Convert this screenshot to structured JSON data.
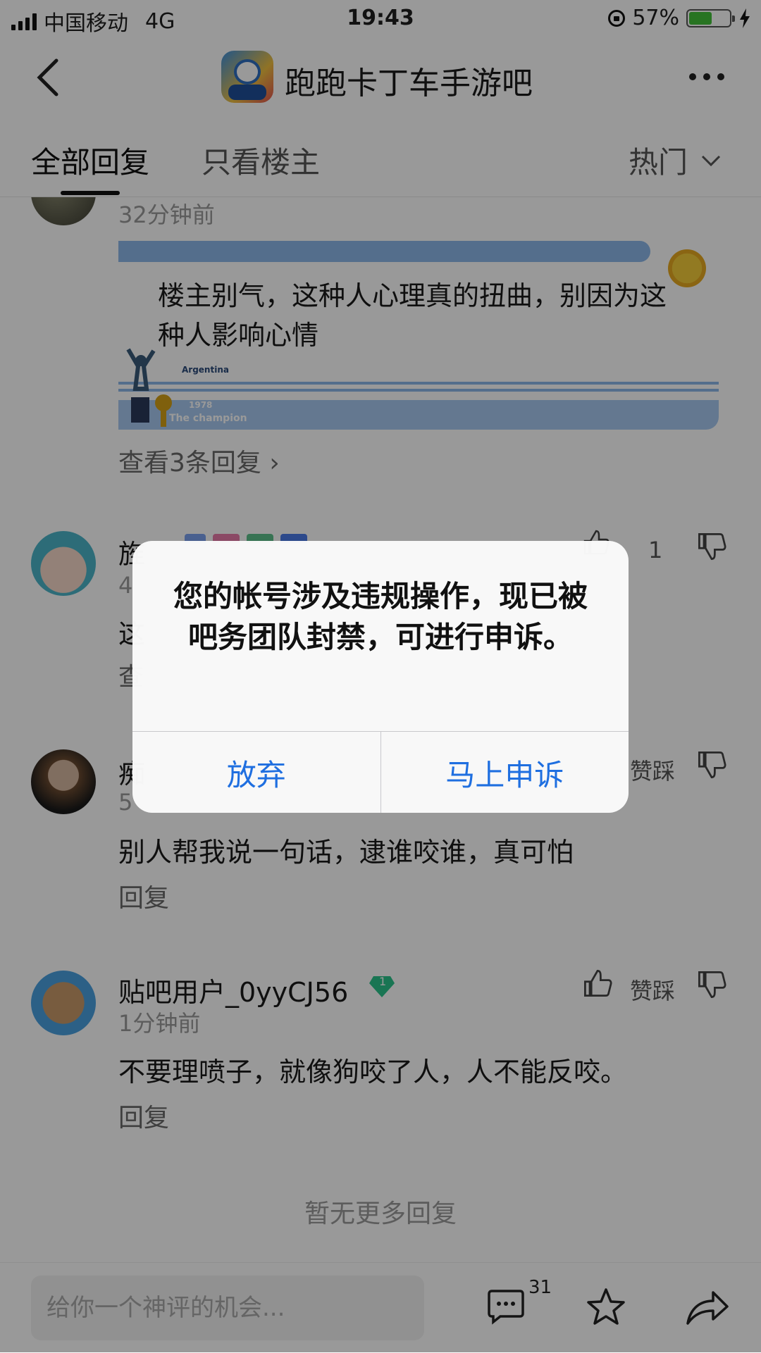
{
  "status_bar": {
    "carrier": "中国移动",
    "network": "4G",
    "time": "19:43",
    "battery": "57%",
    "battery_level": 0.57,
    "battery_color": "#43c23a"
  },
  "header": {
    "back_icon": "chevron-left-icon",
    "forum_name": "跑跑卡丁车手游吧",
    "more_icon": "more-dots-icon"
  },
  "tabs": {
    "all_replies": "全部回复",
    "op_only": "只看楼主",
    "sort": "热门"
  },
  "replies": [
    {
      "time": "32分钟前",
      "text": "楼主别气，这种人心理真的扭曲，别因为这种人影响心情",
      "banner_text_1": "Argentina",
      "banner_text_2": "1978",
      "banner_text_3": "The champion",
      "view_replies": "查看3条回复"
    },
    {
      "username_partial": "旌",
      "time_partial": "4",
      "text_partial": "这",
      "view_partial": "查",
      "like_count": "1"
    },
    {
      "username_partial": "痴",
      "time_partial": "5",
      "dislike_label": "赞踩",
      "text": "别人帮我说一句话，逮谁咬谁，真可怕",
      "reply_label": "回复"
    },
    {
      "username": "贴吧用户_0yyCJ56",
      "level_badge": "1",
      "time": "1分钟前",
      "dislike_label": "赞踩",
      "text": "不要理喷子，就像狗咬了人，人不能反咬。",
      "reply_label": "回复"
    }
  ],
  "no_more_replies": "暂无更多回复",
  "bottom_bar": {
    "input_placeholder": "给你一个神评的机会...",
    "comment_count": "31",
    "comment_icon": "comment-bubble-icon",
    "star_icon": "star-icon",
    "share_icon": "share-arrow-icon"
  },
  "dialog": {
    "message": "您的帐号涉及违规操作，现已被吧务团队封禁，可进行申诉。",
    "cancel_label": "放弃",
    "appeal_label": "马上申诉",
    "button_color": "#1f6fe0"
  }
}
